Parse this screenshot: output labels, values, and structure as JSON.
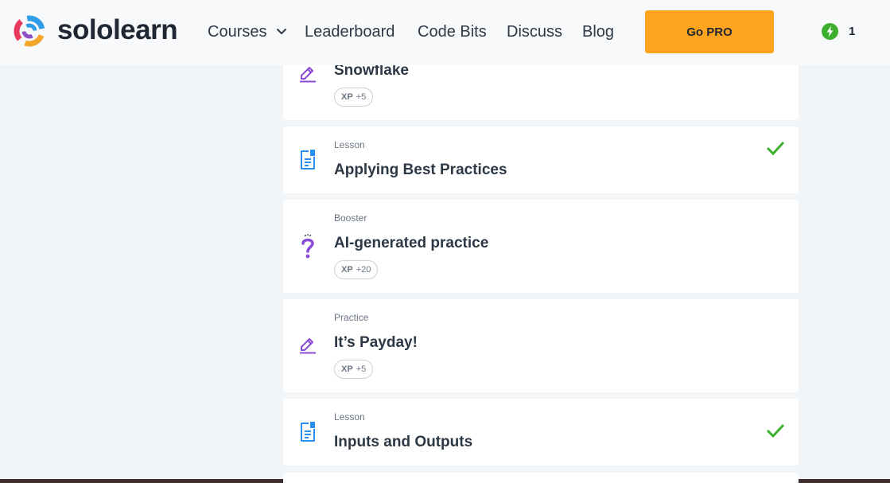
{
  "brand": {
    "name": "sololearn"
  },
  "nav": {
    "courses": "Courses",
    "leaderboard": "Leaderboard",
    "code_bits": "Code Bits",
    "discuss": "Discuss",
    "blog": "Blog"
  },
  "header": {
    "go_pro": "Go PRO",
    "streak_count": "1"
  },
  "colors": {
    "accent_orange": "#fea41e",
    "check_green": "#3cb02e",
    "lesson_blue": "#2a8df0",
    "practice_purple": "#8a4bd6"
  },
  "cards": [
    {
      "type": "",
      "title": "Snowflake",
      "xp_label": "XP",
      "xp_value": "+5",
      "icon": "pencil-icon",
      "completed": false
    },
    {
      "type": "Lesson",
      "title": "Applying Best Practices",
      "icon": "lesson-document-icon",
      "completed": true
    },
    {
      "type": "Booster",
      "title": "AI-generated practice",
      "xp_label": "XP",
      "xp_value": "+20",
      "icon": "question-mark-icon",
      "completed": false
    },
    {
      "type": "Practice",
      "title": "It’s Payday!",
      "xp_label": "XP",
      "xp_value": "+5",
      "icon": "pencil-icon",
      "completed": false
    },
    {
      "type": "Lesson",
      "title": "Inputs and Outputs",
      "icon": "lesson-document-icon",
      "completed": true
    }
  ]
}
